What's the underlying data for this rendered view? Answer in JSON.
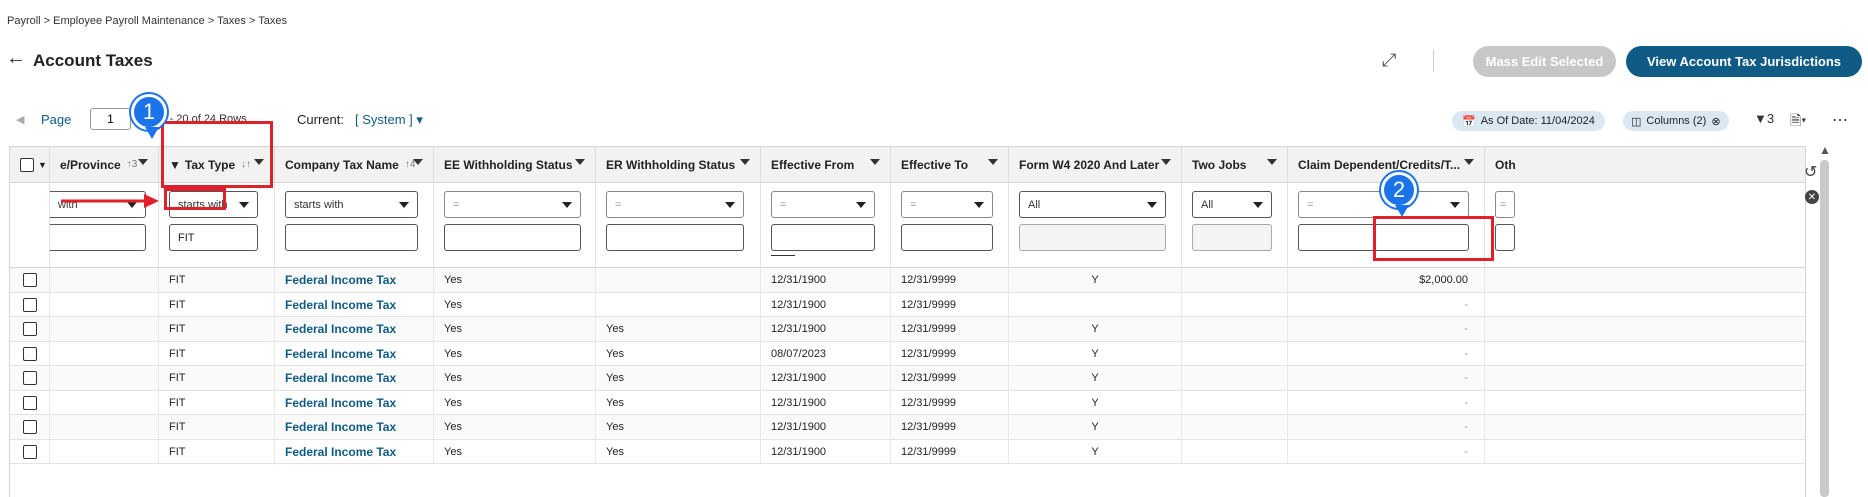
{
  "breadcrumb": "Payroll > Employee Payroll Maintenance > Taxes > Taxes",
  "page_title": "Account Taxes",
  "buttons": {
    "mass_edit": "Mass Edit Selected",
    "view_jurisdictions": "View Account Tax Jurisdictions"
  },
  "pager": {
    "page_label": "Page",
    "page_value": "1",
    "rows_info": "of 2  1 - 20 of 24 Rows",
    "current_label": "Current:",
    "current_value": "[ System ]"
  },
  "chips": {
    "as_of": "As Of Date: 11/04/2024",
    "columns": "Columns (2)",
    "filter_count": "3"
  },
  "columns": [
    {
      "label": "e/Province",
      "sort": "↑3",
      "filter_op": "with",
      "filter_val": ""
    },
    {
      "label": "Tax Type",
      "sort": "↓↑",
      "filter_op": "starts with",
      "filter_val": "FIT"
    },
    {
      "label": "Company Tax Name",
      "sort": "↑4",
      "filter_op": "starts with",
      "filter_val": ""
    },
    {
      "label": "EE Withholding Status",
      "sort": "",
      "filter_op": "=",
      "filter_val": ""
    },
    {
      "label": "ER Withholding Status",
      "sort": "",
      "filter_op": "=",
      "filter_val": ""
    },
    {
      "label": "Effective From",
      "sort": "",
      "filter_op": "=",
      "filter_val": ""
    },
    {
      "label": "Effective To",
      "sort": "",
      "filter_op": "=",
      "filter_val": ""
    },
    {
      "label": "Form W4 2020 And Later",
      "sort": "",
      "filter_op": "All",
      "filter_val": ""
    },
    {
      "label": "Two Jobs",
      "sort": "",
      "filter_op": "All",
      "filter_val": ""
    },
    {
      "label": "Claim Dependent/Credits/T...",
      "sort": "",
      "filter_op": "=",
      "filter_val": ""
    },
    {
      "label": "Oth",
      "sort": "",
      "filter_op": "=",
      "filter_val": ""
    }
  ],
  "rows": [
    {
      "tax_type": "FIT",
      "company": "Federal Income Tax",
      "ee": "Yes",
      "er": "",
      "from": "12/31/1900",
      "to": "12/31/9999",
      "w4": "Y",
      "claim": "$2,000.00"
    },
    {
      "tax_type": "FIT",
      "company": "Federal Income Tax",
      "ee": "Yes",
      "er": "",
      "from": "12/31/1900",
      "to": "12/31/9999",
      "w4": "",
      "claim": "-"
    },
    {
      "tax_type": "FIT",
      "company": "Federal Income Tax",
      "ee": "Yes",
      "er": "Yes",
      "from": "12/31/1900",
      "to": "12/31/9999",
      "w4": "Y",
      "claim": "-"
    },
    {
      "tax_type": "FIT",
      "company": "Federal Income Tax",
      "ee": "Yes",
      "er": "Yes",
      "from": "08/07/2023",
      "to": "12/31/9999",
      "w4": "Y",
      "claim": "-"
    },
    {
      "tax_type": "FIT",
      "company": "Federal Income Tax",
      "ee": "Yes",
      "er": "Yes",
      "from": "12/31/1900",
      "to": "12/31/9999",
      "w4": "Y",
      "claim": "-"
    },
    {
      "tax_type": "FIT",
      "company": "Federal Income Tax",
      "ee": "Yes",
      "er": "Yes",
      "from": "12/31/1900",
      "to": "12/31/9999",
      "w4": "Y",
      "claim": "-"
    },
    {
      "tax_type": "FIT",
      "company": "Federal Income Tax",
      "ee": "Yes",
      "er": "Yes",
      "from": "12/31/1900",
      "to": "12/31/9999",
      "w4": "Y",
      "claim": "-"
    },
    {
      "tax_type": "FIT",
      "company": "Federal Income Tax",
      "ee": "Yes",
      "er": "Yes",
      "from": "12/31/1900",
      "to": "12/31/9999",
      "w4": "Y",
      "claim": "-"
    }
  ],
  "markers": [
    "1",
    "2"
  ],
  "colors": {
    "accent": "#0f5b86",
    "annotation_red": "#e0202a",
    "marker_blue": "#1a73e8"
  }
}
